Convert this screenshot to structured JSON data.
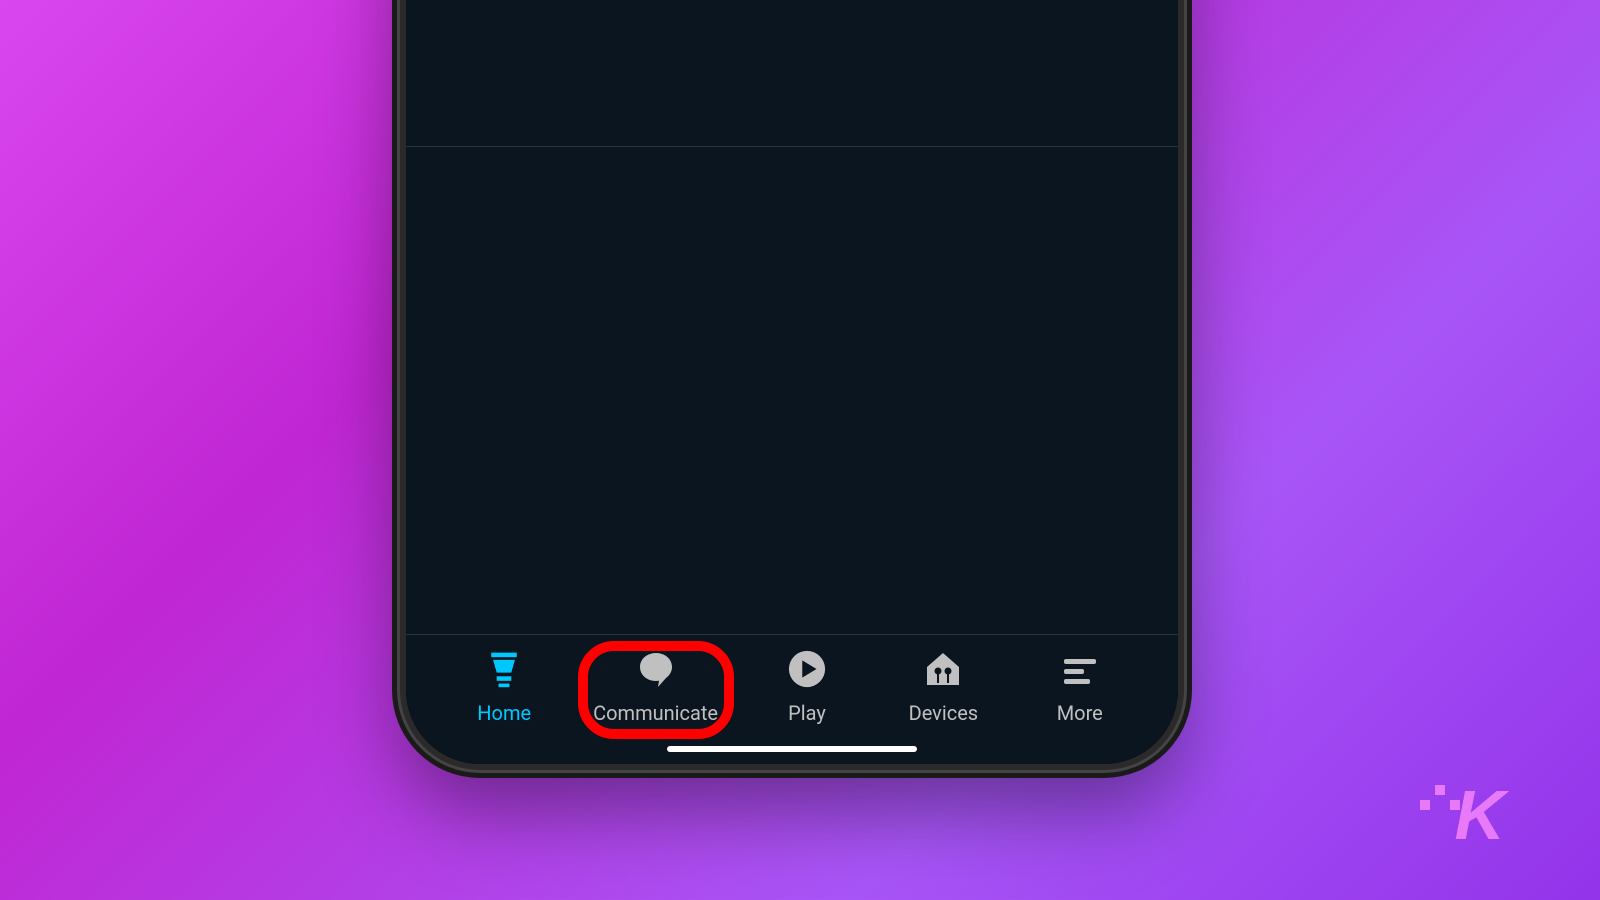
{
  "tabs": [
    {
      "label": "Home",
      "icon": "home-icon",
      "active": true,
      "highlighted": false
    },
    {
      "label": "Communicate",
      "icon": "speech-bubble-icon",
      "active": false,
      "highlighted": true
    },
    {
      "label": "Play",
      "icon": "play-circle-icon",
      "active": false,
      "highlighted": false
    },
    {
      "label": "Devices",
      "icon": "house-devices-icon",
      "active": false,
      "highlighted": false
    },
    {
      "label": "More",
      "icon": "menu-lines-icon",
      "active": false,
      "highlighted": false
    }
  ],
  "colors": {
    "active": "#00c8ff",
    "inactive": "#c0c0c0",
    "highlight": "#ff0000",
    "background": "#0a1520"
  },
  "watermark": "K"
}
